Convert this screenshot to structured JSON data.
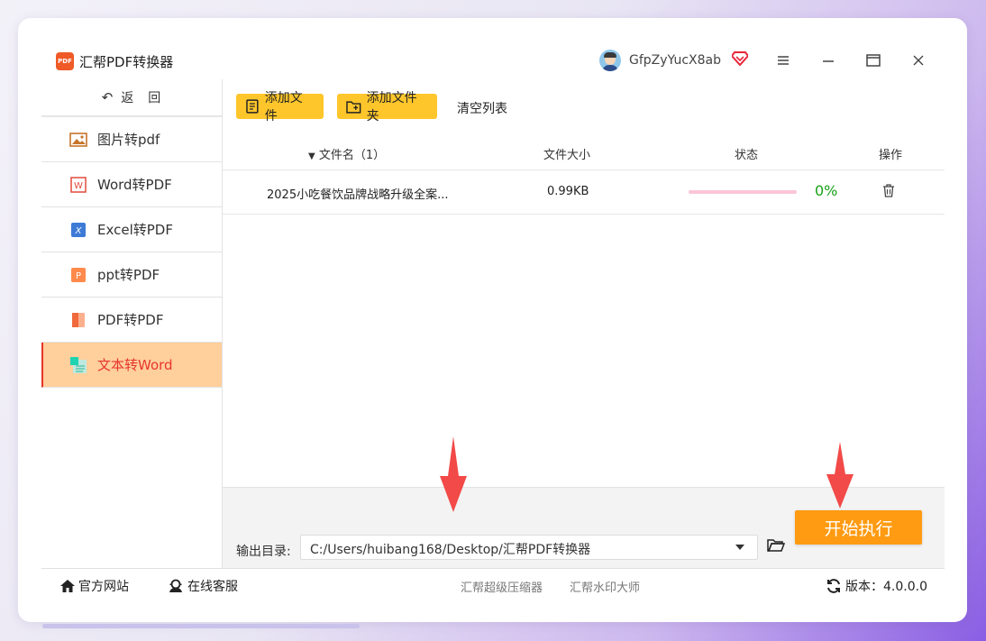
{
  "window": {
    "title": "汇帮PDF转换器",
    "logo_text": "PDF",
    "username": "GfpZyYucX8ab",
    "colors": {
      "accent": "#ffc62b",
      "start": "#ff9b12",
      "active_nav": "#ffcf9c",
      "active_text": "#e8352b",
      "progress_text": "#17a317"
    }
  },
  "sidebar": {
    "back_label": "返　回",
    "items": [
      {
        "label": "图片转pdf",
        "icon": "image-icon"
      },
      {
        "label": "Word转PDF",
        "icon": "word-icon"
      },
      {
        "label": "Excel转PDF",
        "icon": "excel-icon"
      },
      {
        "label": "ppt转PDF",
        "icon": "ppt-icon"
      },
      {
        "label": "PDF转PDF",
        "icon": "pdf-icon"
      },
      {
        "label": "文本转Word",
        "icon": "text-icon",
        "active": true
      }
    ]
  },
  "toolbar": {
    "add_file": "添加文件",
    "add_folder": "添加文件夹",
    "clear_list": "清空列表"
  },
  "table": {
    "headers": {
      "name": "文件名（1）",
      "size": "文件大小",
      "status": "状态",
      "action": "操作"
    },
    "rows": [
      {
        "name": "2025小吃餐饮品牌战略升级全案...",
        "size": "0.99KB",
        "progress": 0,
        "progress_text": "0%"
      }
    ]
  },
  "output": {
    "label": "输出目录:",
    "path": "C:/Users/huibang168/Desktop/汇帮PDF转换器",
    "start_label": "开始执行"
  },
  "footer": {
    "official_site": "官方网站",
    "online_service": "在线客服",
    "link1": "汇帮超级压缩器",
    "link2": "汇帮水印大师",
    "version": "版本：4.0.0.0"
  }
}
